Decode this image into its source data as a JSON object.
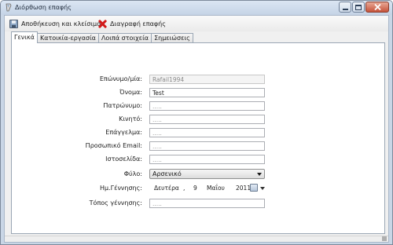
{
  "window": {
    "title": "Διόρθωση επαφής"
  },
  "toolbar": {
    "save_label": "Αποθήκευση και κλείσιμο",
    "delete_label": "Διαγραφή επαφής"
  },
  "tabs": [
    {
      "label": "Γενικά",
      "active": true
    },
    {
      "label": "Κατοικία-εργασία",
      "active": false
    },
    {
      "label": "Λοιπά στοιχεία",
      "active": false
    },
    {
      "label": "Σημειώσεις",
      "active": false
    }
  ],
  "form": {
    "surname": {
      "label": "Επώνυμο/μία:",
      "value": "Rafail1994"
    },
    "firstname": {
      "label": "Όνομα:",
      "value": "Test"
    },
    "fathername": {
      "label": "Πατρώνυμο:",
      "placeholder": "....."
    },
    "mobile": {
      "label": "Κινητό:",
      "placeholder": "....."
    },
    "profession": {
      "label": "Επάγγελμα:",
      "placeholder": "....."
    },
    "email": {
      "label": "Προσωπικό Email:",
      "placeholder": "....."
    },
    "website": {
      "label": "Ιστοσελίδα:",
      "placeholder": "....."
    },
    "gender": {
      "label": "Φύλο:",
      "value": "Αρσενικό"
    },
    "birthdate": {
      "label": "Ημ.Γέννησης:",
      "weekday": "Δευτέρα",
      "day": "9",
      "month": "Μαΐου",
      "year": "2011"
    },
    "birthplace": {
      "label": "Τόπος γέννησης:",
      "placeholder": "....."
    }
  }
}
